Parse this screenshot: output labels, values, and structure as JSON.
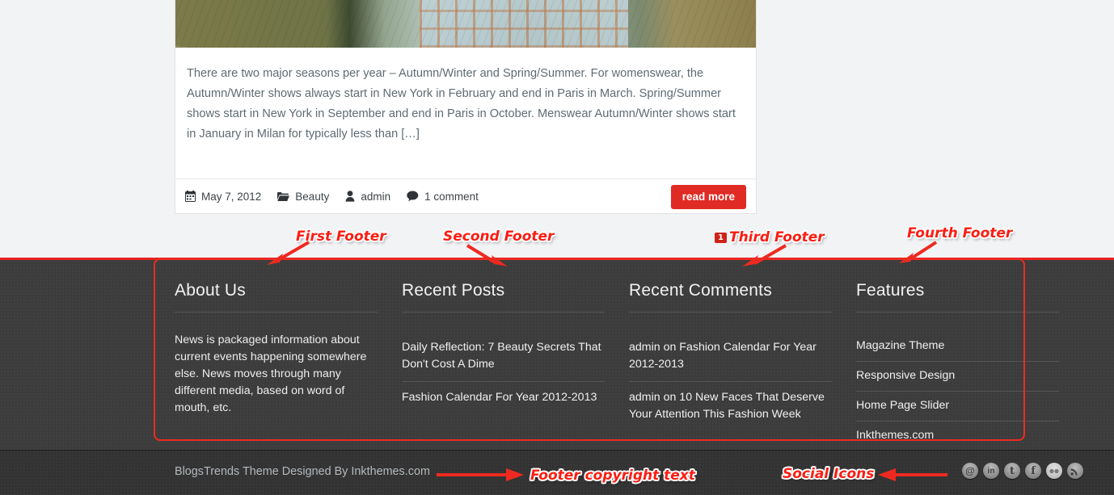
{
  "article": {
    "thumbnail_alt": "man in plaid shirt photo",
    "excerpt": "There are two major seasons per year – Autumn/Winter and Spring/Summer. For womenswear, the Autumn/Winter shows always start in New York in February and end in Paris in March. Spring/Summer shows start in New York in September and end in Paris in October. Menswear Autumn/Winter shows start in January in Milan for typically less than […]",
    "meta": {
      "date": "May 7, 2012",
      "category": "Beauty",
      "author": "admin",
      "comments": "1 comment"
    },
    "read_more_label": "read more"
  },
  "footer": {
    "widgets": [
      {
        "title": "About Us",
        "type": "text",
        "text": "News is packaged information about current events happening somewhere else. News moves through many different media, based on word of mouth, etc."
      },
      {
        "title": "Recent Posts",
        "type": "list",
        "items": [
          "Daily Reflection: 7 Beauty Secrets That Don't Cost A Dime",
          "Fashion Calendar For Year 2012-2013"
        ]
      },
      {
        "title": "Recent Comments",
        "type": "list",
        "items": [
          "admin on Fashion Calendar For Year 2012-2013",
          "admin on 10 New Faces That Deserve Your Attention This Fashion Week"
        ]
      },
      {
        "title": "Features",
        "type": "list",
        "items": [
          "Magazine Theme",
          "Responsive Design",
          "Home Page Slider",
          "Inkthemes.com"
        ]
      }
    ],
    "copyright": "BlogsTrends Theme Designed By Inkthemes.com",
    "social_icons": [
      {
        "name": "email-icon",
        "glyph": "@"
      },
      {
        "name": "linkedin-icon",
        "glyph": "in"
      },
      {
        "name": "twitter-icon",
        "glyph": "t"
      },
      {
        "name": "facebook-icon",
        "glyph": "f"
      },
      {
        "name": "flickr-icon",
        "glyph": ""
      },
      {
        "name": "rss-icon",
        "glyph": ""
      }
    ]
  },
  "annotations": {
    "first_footer": "First Footer",
    "second_footer": "Second Footer",
    "third_footer_badge": "1",
    "third_footer": "Third Footer",
    "fourth_footer": "Fourth Footer",
    "footer_copyright_text": "Footer copyright text",
    "social_icons_label": "Social Icons"
  },
  "colors": {
    "accent_red": "#e02b25",
    "annotation_red": "#fb1d12",
    "footer_bg": "#3c3c3c",
    "bottom_bar_bg": "#333333",
    "page_bg": "#f2f3f5"
  }
}
